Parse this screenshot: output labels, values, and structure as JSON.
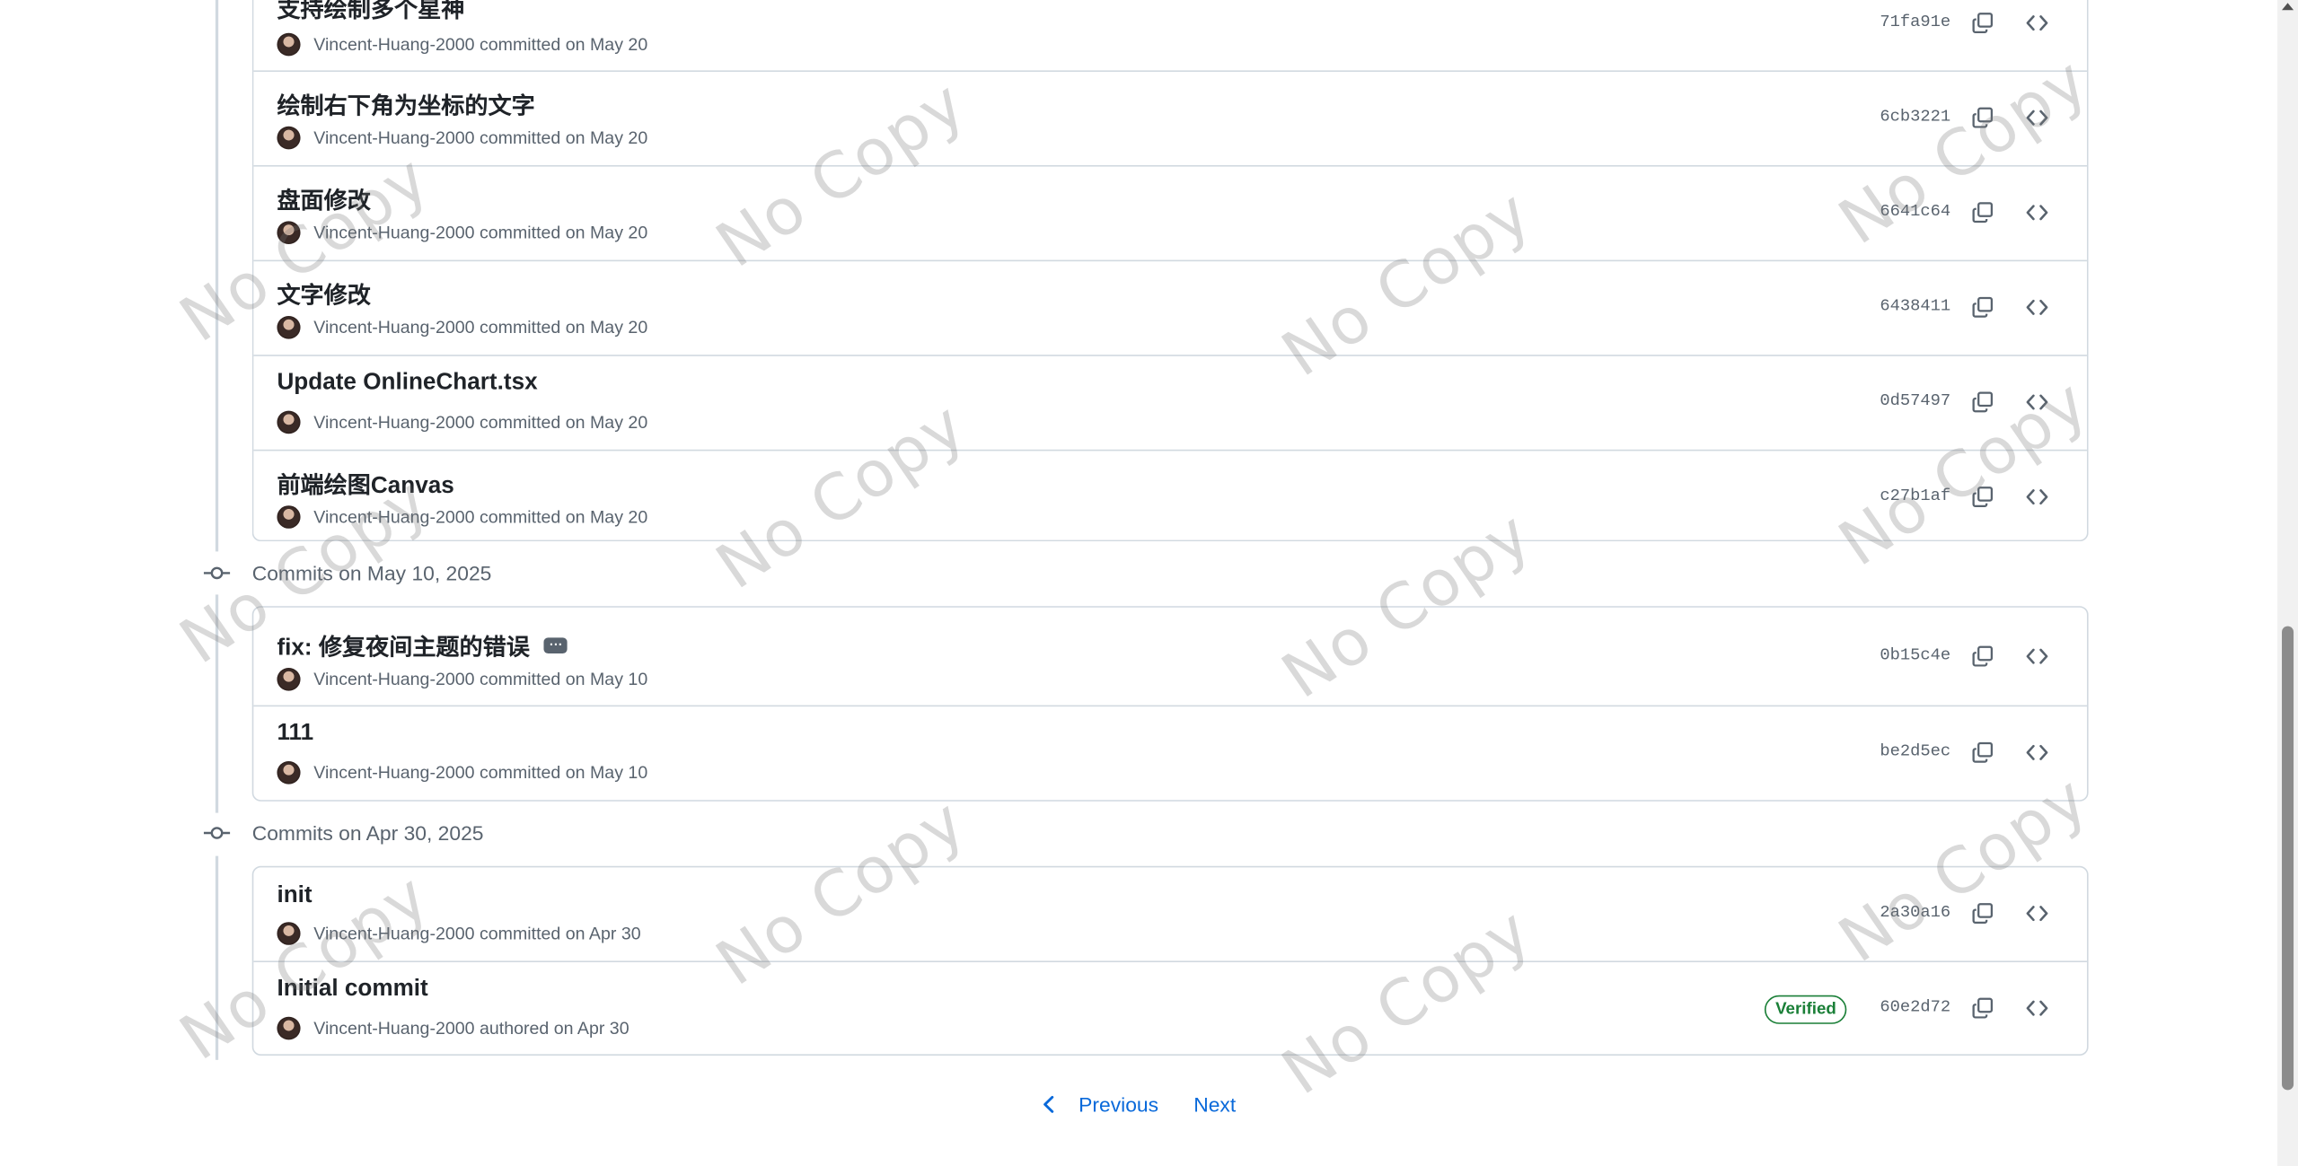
{
  "groups": [
    {
      "label": "",
      "commits": [
        {
          "title": "支持绘制多个星神",
          "author": "Vincent-Huang-2000",
          "action": "committed on May 20",
          "sha": "71fa91e"
        },
        {
          "title": "绘制右下角为坐标的文字",
          "author": "Vincent-Huang-2000",
          "action": "committed on May 20",
          "sha": "6cb3221"
        },
        {
          "title": "盘面修改",
          "author": "Vincent-Huang-2000",
          "action": "committed on May 20",
          "sha": "6641c64"
        },
        {
          "title": "文字修改",
          "author": "Vincent-Huang-2000",
          "action": "committed on May 20",
          "sha": "6438411"
        },
        {
          "title": "Update OnlineChart.tsx",
          "author": "Vincent-Huang-2000",
          "action": "committed on May 20",
          "sha": "0d57497"
        },
        {
          "title": "前端绘图Canvas",
          "author": "Vincent-Huang-2000",
          "action": "committed on May 20",
          "sha": "c27b1af"
        }
      ]
    },
    {
      "label": "Commits on May 10, 2025",
      "commits": [
        {
          "title": "fix: 修复夜间主题的错误",
          "ellipsis": "···",
          "author": "Vincent-Huang-2000",
          "action": "committed on May 10",
          "sha": "0b15c4e"
        },
        {
          "title": "111",
          "author": "Vincent-Huang-2000",
          "action": "committed on May 10",
          "sha": "be2d5ec"
        }
      ]
    },
    {
      "label": "Commits on Apr 30, 2025",
      "commits": [
        {
          "title": "init",
          "author": "Vincent-Huang-2000",
          "action": "committed on Apr 30",
          "sha": "2a30a16"
        },
        {
          "title": "Initial commit",
          "author": "Vincent-Huang-2000",
          "action": "authored on Apr 30",
          "sha": "60e2d72",
          "badge": "Verified"
        }
      ]
    }
  ],
  "pagination": {
    "previous": "Previous",
    "next": "Next"
  },
  "watermark": "No Copy",
  "colors": {
    "link": "#0969da",
    "border": "#d1d9e0",
    "muted": "#59636e",
    "verified": "#1a7f37"
  },
  "icons": {
    "copy": "copy-icon",
    "browse": "code-icon",
    "node": "git-commit-icon",
    "prev": "chevron-left-icon"
  }
}
